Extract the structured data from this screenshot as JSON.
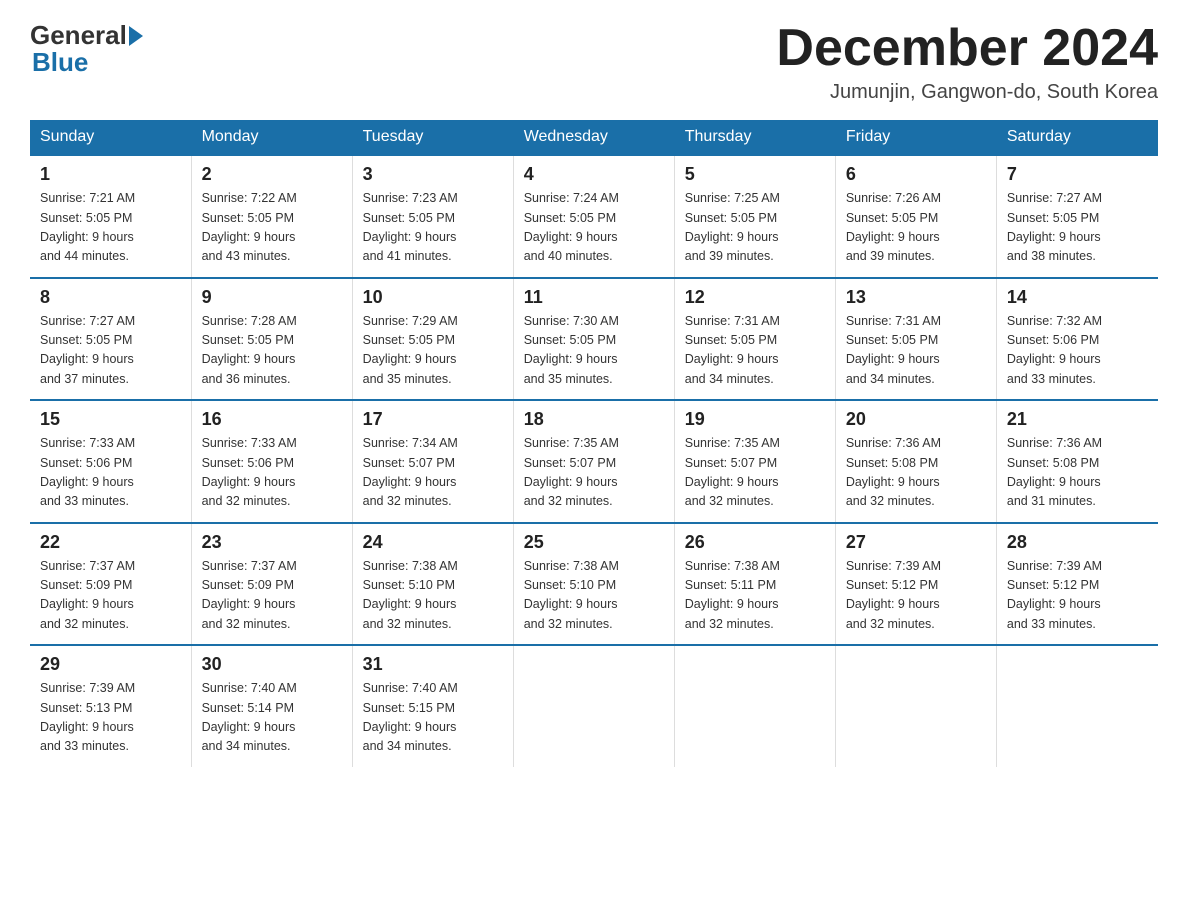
{
  "header": {
    "logo_general": "General",
    "logo_blue": "Blue",
    "title": "December 2024",
    "location": "Jumunjin, Gangwon-do, South Korea"
  },
  "days_of_week": [
    "Sunday",
    "Monday",
    "Tuesday",
    "Wednesday",
    "Thursday",
    "Friday",
    "Saturday"
  ],
  "weeks": [
    [
      {
        "num": "1",
        "sunrise": "7:21 AM",
        "sunset": "5:05 PM",
        "daylight": "9 hours and 44 minutes."
      },
      {
        "num": "2",
        "sunrise": "7:22 AM",
        "sunset": "5:05 PM",
        "daylight": "9 hours and 43 minutes."
      },
      {
        "num": "3",
        "sunrise": "7:23 AM",
        "sunset": "5:05 PM",
        "daylight": "9 hours and 41 minutes."
      },
      {
        "num": "4",
        "sunrise": "7:24 AM",
        "sunset": "5:05 PM",
        "daylight": "9 hours and 40 minutes."
      },
      {
        "num": "5",
        "sunrise": "7:25 AM",
        "sunset": "5:05 PM",
        "daylight": "9 hours and 39 minutes."
      },
      {
        "num": "6",
        "sunrise": "7:26 AM",
        "sunset": "5:05 PM",
        "daylight": "9 hours and 39 minutes."
      },
      {
        "num": "7",
        "sunrise": "7:27 AM",
        "sunset": "5:05 PM",
        "daylight": "9 hours and 38 minutes."
      }
    ],
    [
      {
        "num": "8",
        "sunrise": "7:27 AM",
        "sunset": "5:05 PM",
        "daylight": "9 hours and 37 minutes."
      },
      {
        "num": "9",
        "sunrise": "7:28 AM",
        "sunset": "5:05 PM",
        "daylight": "9 hours and 36 minutes."
      },
      {
        "num": "10",
        "sunrise": "7:29 AM",
        "sunset": "5:05 PM",
        "daylight": "9 hours and 35 minutes."
      },
      {
        "num": "11",
        "sunrise": "7:30 AM",
        "sunset": "5:05 PM",
        "daylight": "9 hours and 35 minutes."
      },
      {
        "num": "12",
        "sunrise": "7:31 AM",
        "sunset": "5:05 PM",
        "daylight": "9 hours and 34 minutes."
      },
      {
        "num": "13",
        "sunrise": "7:31 AM",
        "sunset": "5:05 PM",
        "daylight": "9 hours and 34 minutes."
      },
      {
        "num": "14",
        "sunrise": "7:32 AM",
        "sunset": "5:06 PM",
        "daylight": "9 hours and 33 minutes."
      }
    ],
    [
      {
        "num": "15",
        "sunrise": "7:33 AM",
        "sunset": "5:06 PM",
        "daylight": "9 hours and 33 minutes."
      },
      {
        "num": "16",
        "sunrise": "7:33 AM",
        "sunset": "5:06 PM",
        "daylight": "9 hours and 32 minutes."
      },
      {
        "num": "17",
        "sunrise": "7:34 AM",
        "sunset": "5:07 PM",
        "daylight": "9 hours and 32 minutes."
      },
      {
        "num": "18",
        "sunrise": "7:35 AM",
        "sunset": "5:07 PM",
        "daylight": "9 hours and 32 minutes."
      },
      {
        "num": "19",
        "sunrise": "7:35 AM",
        "sunset": "5:07 PM",
        "daylight": "9 hours and 32 minutes."
      },
      {
        "num": "20",
        "sunrise": "7:36 AM",
        "sunset": "5:08 PM",
        "daylight": "9 hours and 32 minutes."
      },
      {
        "num": "21",
        "sunrise": "7:36 AM",
        "sunset": "5:08 PM",
        "daylight": "9 hours and 31 minutes."
      }
    ],
    [
      {
        "num": "22",
        "sunrise": "7:37 AM",
        "sunset": "5:09 PM",
        "daylight": "9 hours and 32 minutes."
      },
      {
        "num": "23",
        "sunrise": "7:37 AM",
        "sunset": "5:09 PM",
        "daylight": "9 hours and 32 minutes."
      },
      {
        "num": "24",
        "sunrise": "7:38 AM",
        "sunset": "5:10 PM",
        "daylight": "9 hours and 32 minutes."
      },
      {
        "num": "25",
        "sunrise": "7:38 AM",
        "sunset": "5:10 PM",
        "daylight": "9 hours and 32 minutes."
      },
      {
        "num": "26",
        "sunrise": "7:38 AM",
        "sunset": "5:11 PM",
        "daylight": "9 hours and 32 minutes."
      },
      {
        "num": "27",
        "sunrise": "7:39 AM",
        "sunset": "5:12 PM",
        "daylight": "9 hours and 32 minutes."
      },
      {
        "num": "28",
        "sunrise": "7:39 AM",
        "sunset": "5:12 PM",
        "daylight": "9 hours and 33 minutes."
      }
    ],
    [
      {
        "num": "29",
        "sunrise": "7:39 AM",
        "sunset": "5:13 PM",
        "daylight": "9 hours and 33 minutes."
      },
      {
        "num": "30",
        "sunrise": "7:40 AM",
        "sunset": "5:14 PM",
        "daylight": "9 hours and 34 minutes."
      },
      {
        "num": "31",
        "sunrise": "7:40 AM",
        "sunset": "5:15 PM",
        "daylight": "9 hours and 34 minutes."
      },
      null,
      null,
      null,
      null
    ]
  ],
  "labels": {
    "sunrise": "Sunrise:",
    "sunset": "Sunset:",
    "daylight": "Daylight:"
  }
}
